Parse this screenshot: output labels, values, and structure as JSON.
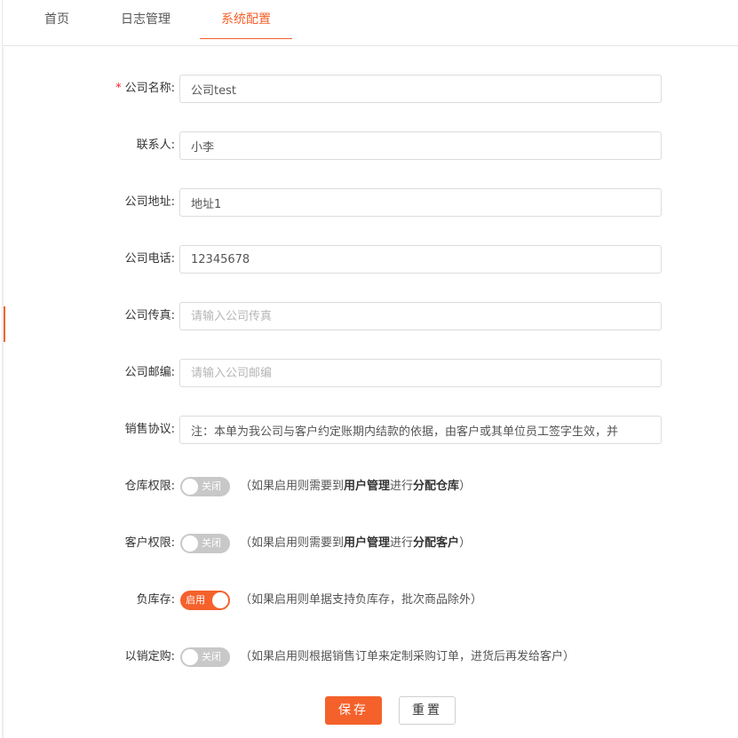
{
  "tabs": [
    {
      "label": "首页"
    },
    {
      "label": "日志管理"
    },
    {
      "label": "系统配置"
    }
  ],
  "form": {
    "company_name": {
      "label": "公司名称:",
      "required_mark": "*",
      "value": "公司test"
    },
    "contact": {
      "label": "联系人:",
      "value": "小李"
    },
    "address": {
      "label": "公司地址:",
      "value": "地址1"
    },
    "phone": {
      "label": "公司电话:",
      "value": "12345678"
    },
    "fax": {
      "label": "公司传真:",
      "value": "",
      "placeholder": "请输入公司传真"
    },
    "postcode": {
      "label": "公司邮编:",
      "value": "",
      "placeholder": "请输入公司邮编"
    },
    "sales_agreement": {
      "label": "销售协议:",
      "value": "注：本单为我公司与客户约定账期内结款的依据，由客户或其单位员工签字生效，并"
    },
    "warehouse_permission": {
      "label": "仓库权限:",
      "state": "关闭",
      "enabled": false,
      "hint_prefix": "（如果启用则需要到",
      "hint_bold1": "用户管理",
      "hint_mid": "进行",
      "hint_bold2": "分配仓库",
      "hint_suffix": "）"
    },
    "customer_permission": {
      "label": "客户权限:",
      "state": "关闭",
      "enabled": false,
      "hint_prefix": "（如果启用则需要到",
      "hint_bold1": "用户管理",
      "hint_mid": "进行",
      "hint_bold2": "分配客户",
      "hint_suffix": "）"
    },
    "negative_stock": {
      "label": "负库存:",
      "state": "启用",
      "enabled": true,
      "hint": "（如果启用则单据支持负库存，批次商品除外）"
    },
    "purchase_by_sales": {
      "label": "以销定购:",
      "state": "关闭",
      "enabled": false,
      "hint": "（如果启用则根据销售订单来定制采购订单，进货后再发给客户）"
    }
  },
  "buttons": {
    "save": "保存",
    "reset": "重置"
  },
  "colors": {
    "accent": "#f5612b",
    "switch_off": "#c8c8c8",
    "required": "#f5222d"
  }
}
